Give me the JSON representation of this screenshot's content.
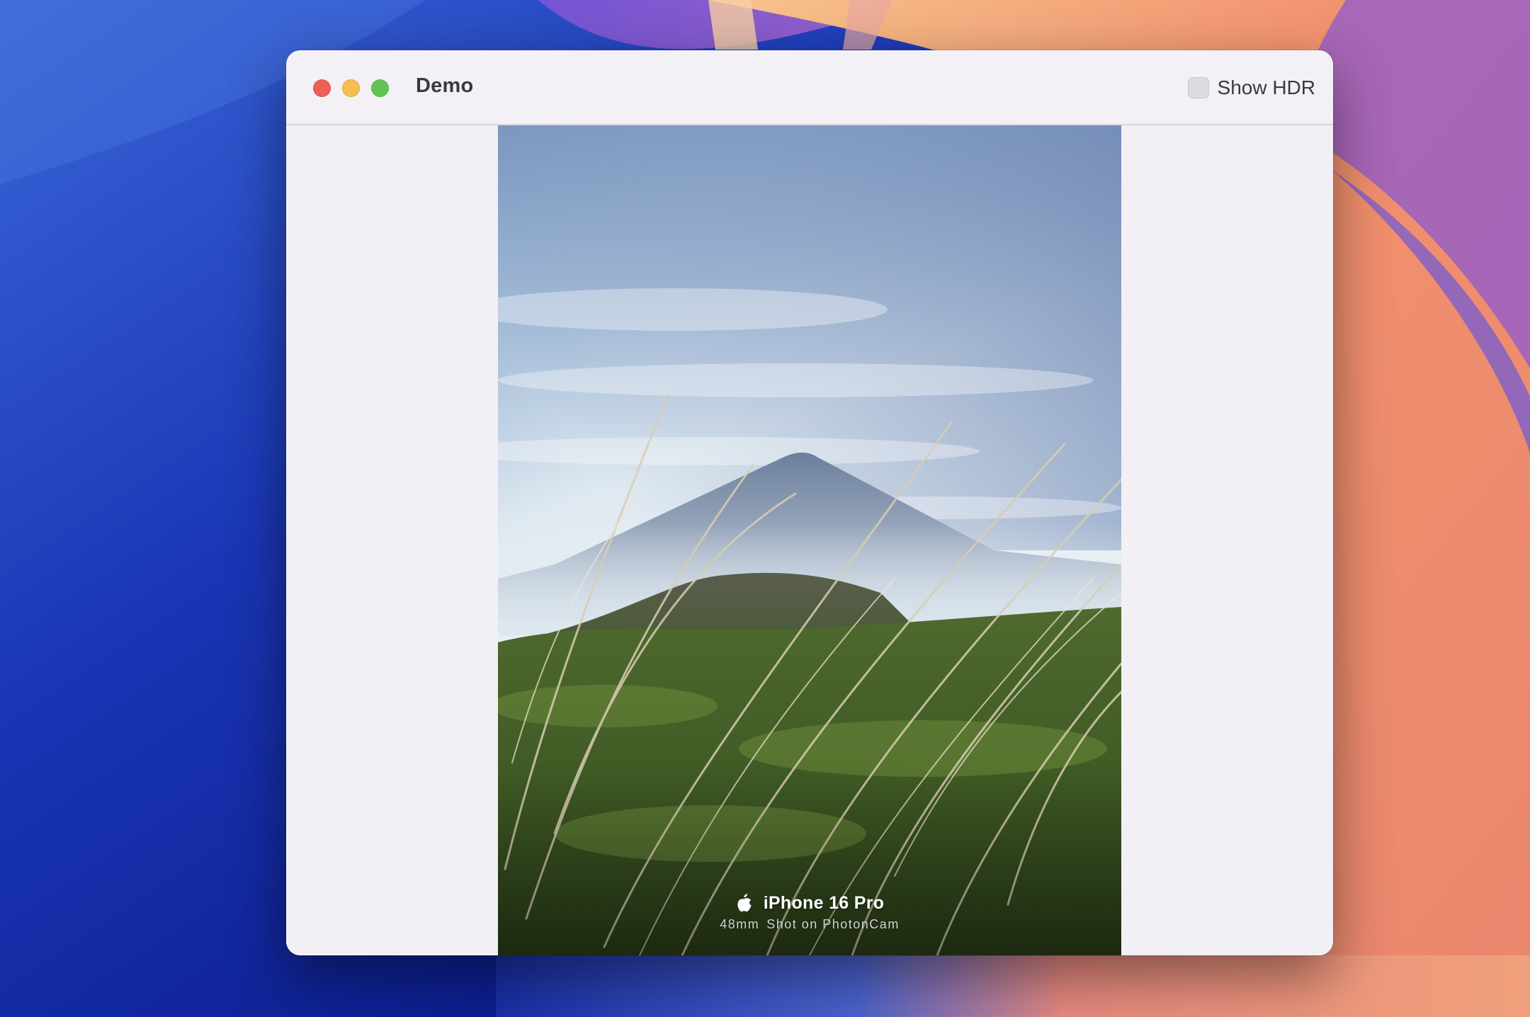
{
  "window": {
    "title": "Demo",
    "show_hdr_label": "Show HDR",
    "show_hdr_checked": false
  },
  "photo": {
    "device": "iPhone 16 Pro",
    "focal_length": "48mm",
    "shot_on": "Shot on PhotonCam"
  },
  "colors": {
    "close": "#ee5f57",
    "minimize": "#f5be4f",
    "maximize": "#61c454",
    "window_bg": "#f2f0f5"
  },
  "icons": [
    "close-icon",
    "minimize-icon",
    "maximize-icon",
    "checkbox-icon",
    "apple-logo-icon"
  ]
}
